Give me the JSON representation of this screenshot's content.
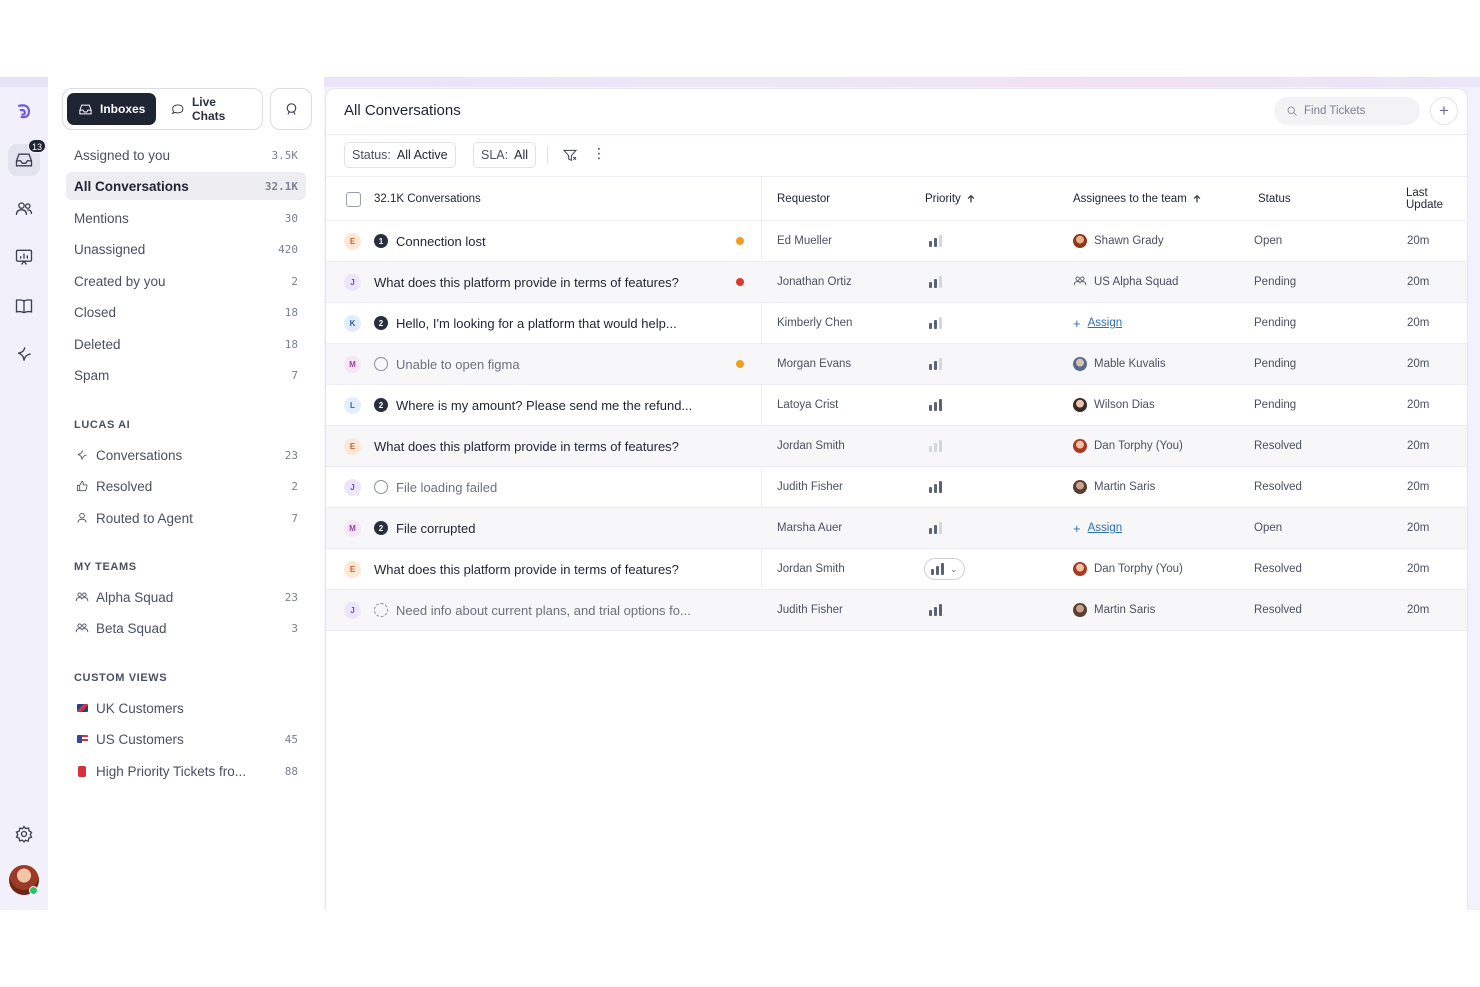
{
  "rail": {
    "inbox_badge": "13",
    "icons": [
      "logo-icon",
      "inbox-icon",
      "users-icon",
      "reports-icon",
      "knowledge-base-icon",
      "ai-sparkle-icon",
      "settings-icon"
    ]
  },
  "sidebar": {
    "tabs": [
      {
        "label": "Inboxes",
        "icon": "inbox-icon",
        "active": true
      },
      {
        "label": "Live Chats",
        "icon": "chat-bubble-icon",
        "active": false
      }
    ],
    "nav": [
      {
        "label": "Assigned to you",
        "count": "3.5K"
      },
      {
        "label": "All Conversations",
        "count": "32.1K",
        "active": true
      },
      {
        "label": "Mentions",
        "count": "30"
      },
      {
        "label": "Unassigned",
        "count": "420"
      },
      {
        "label": "Created by you",
        "count": "2"
      },
      {
        "label": "Closed",
        "count": "18"
      },
      {
        "label": "Deleted",
        "count": "18"
      },
      {
        "label": "Spam",
        "count": "7"
      }
    ],
    "lucas_ai": {
      "heading": "LUCAS AI",
      "items": [
        {
          "label": "Conversations",
          "count": "23",
          "icon": "sparkle-icon"
        },
        {
          "label": "Resolved",
          "count": "2",
          "icon": "thumbs-up-icon"
        },
        {
          "label": "Routed to Agent",
          "count": "7",
          "icon": "agent-icon"
        }
      ]
    },
    "my_teams": {
      "heading": "MY TEAMS",
      "items": [
        {
          "label": "Alpha Squad",
          "count": "23",
          "icon": "team-icon"
        },
        {
          "label": "Beta Squad",
          "count": "3",
          "icon": "team-icon"
        }
      ]
    },
    "custom_views": {
      "heading": "CUSTOM VIEWS",
      "items": [
        {
          "label": "UK Customers",
          "count": "",
          "icon": "uk-flag-icon"
        },
        {
          "label": "US Customers",
          "count": "45",
          "icon": "us-flag-icon"
        },
        {
          "label": "High Priority Tickets fro...",
          "count": "88",
          "icon": "alert-icon"
        }
      ]
    }
  },
  "main": {
    "title": "All Conversations",
    "search_placeholder": "Find Tickets",
    "filters": {
      "status_label": "Status:",
      "status_value": "All Active",
      "sla_label": "SLA:",
      "sla_value": "All"
    },
    "columns": {
      "select": "32.1K Conversations",
      "requestor": "Requestor",
      "priority": "Priority",
      "assignees": "Assignees to the team",
      "status": "Status",
      "last_update": "Last Update"
    },
    "rows": [
      {
        "initial": "E",
        "subject": "Connection lost",
        "state_icon": "1",
        "requestor": "Ed Mueller",
        "priority": 2,
        "assignee": "Shawn Grady",
        "status": "Open",
        "updated": "20m",
        "dot": "#f0a020"
      },
      {
        "initial": "J",
        "subject": "What does this platform provide in terms of features?",
        "state_icon": "",
        "requestor": "Jonathan Ortiz",
        "priority": 2,
        "assignee": "US Alpha Squad",
        "status": "Pending",
        "updated": "20m",
        "dot": "#d93b30"
      },
      {
        "initial": "K",
        "subject": "Hello, I'm looking for a platform that would help...",
        "state_icon": "2",
        "requestor": "Kimberly Chen",
        "priority": 2,
        "assignee": "Assign",
        "status": "Pending",
        "updated": "20m",
        "dot": ""
      },
      {
        "initial": "M",
        "subject": "Unable to open figma",
        "state_icon": "o",
        "requestor": "Morgan Evans",
        "priority": 2,
        "assignee": "Mable Kuvalis",
        "status": "Pending",
        "updated": "20m",
        "dot": "#f0a020"
      },
      {
        "initial": "L",
        "subject": "Where is my amount? Please send me the refund...",
        "state_icon": "2",
        "requestor": "Latoya Crist",
        "priority": 3,
        "assignee": "Wilson Dias",
        "status": "Pending",
        "updated": "20m",
        "dot": ""
      },
      {
        "initial": "E",
        "subject": "What does this platform provide in terms of features?",
        "state_icon": "",
        "requestor": "Jordan Smith",
        "priority": 0,
        "assignee": "Dan Torphy (You)",
        "status": "Resolved",
        "updated": "20m",
        "dot": ""
      },
      {
        "initial": "J",
        "subject": "File loading failed",
        "state_icon": "o",
        "requestor": "Judith Fisher",
        "priority": 3,
        "assignee": "Martin Saris",
        "status": "Resolved",
        "updated": "20m",
        "dot": ""
      },
      {
        "initial": "M",
        "subject": "File corrupted",
        "state_icon": "2",
        "requestor": "Marsha Auer",
        "priority": 2,
        "assignee": "Assign",
        "status": "Open",
        "updated": "20m",
        "dot": ""
      },
      {
        "initial": "E",
        "subject": "What does this platform provide in terms of features?",
        "state_icon": "",
        "requestor": "Jordan Smith",
        "priority": 3,
        "assignee": "Dan Torphy (You)",
        "status": "Resolved",
        "updated": "20m",
        "dot": ""
      },
      {
        "initial": "J",
        "subject": "Need info about current plans, and trial options fo...",
        "state_icon": "d",
        "requestor": "Judith Fisher",
        "priority": 3,
        "assignee": "Martin Saris",
        "status": "Resolved",
        "updated": "20m",
        "dot": ""
      }
    ]
  },
  "colors": {
    "accent_dark": "#1f2433",
    "link": "#2f6fb0",
    "brand": "#6b57e8"
  }
}
